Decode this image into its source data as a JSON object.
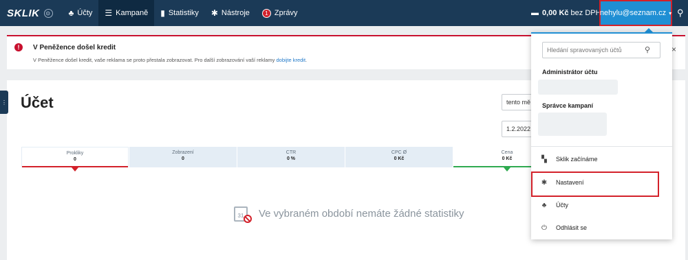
{
  "nav": {
    "logo": "SKLIK",
    "logo_badge": "⊙",
    "items": [
      {
        "label": "Účty",
        "icon": "accounts-icon",
        "glyph": "♣"
      },
      {
        "label": "Kampaně",
        "icon": "list-icon",
        "glyph": "☰"
      },
      {
        "label": "Statistiky",
        "icon": "bar-chart-icon",
        "glyph": "▮"
      },
      {
        "label": "Nástroje",
        "icon": "gear-icon",
        "glyph": "✱"
      },
      {
        "label": "Zprávy",
        "icon": "messages-icon",
        "badge": "1"
      }
    ],
    "credit_amount": "0,00 Kč",
    "credit_suffix": "bez DPH",
    "credit_caret": "▾",
    "user_email": "nehylu@seznam.cz",
    "user_caret": "▾"
  },
  "alert": {
    "title": "V Peněžence došel kredit",
    "text": "V Peněžence došel kredit, vaše reklama se proto přestala zobrazovat. Pro další zobrazování vaší reklamy ",
    "link": "dobijte kredit",
    "text_end": ".",
    "close": "×"
  },
  "page": {
    "title": "Účet",
    "period_select": "tento mě",
    "date_field": "1.2.2022"
  },
  "stats": [
    {
      "label": "Prokliky",
      "value": "0"
    },
    {
      "label": "Zobrazení",
      "value": "0"
    },
    {
      "label": "CTR",
      "value": "0 %"
    },
    {
      "label": "CPC Ø",
      "value": "0 Kč"
    },
    {
      "label": "Cena",
      "value": "0 Kč"
    }
  ],
  "empty": {
    "calendar_day": "31",
    "message": "Ve vybraném období nemáte žádné statistiky"
  },
  "dropdown": {
    "search_placeholder": "Hledání spravovaných účtů",
    "admin_heading": "Administrátor účtu",
    "manager_heading": "Správce kampaní",
    "items": [
      {
        "label": "Sklik začínáme",
        "glyph": "▚"
      },
      {
        "label": "Nastavení",
        "glyph": "✱"
      },
      {
        "label": "Účty",
        "glyph": "♣"
      },
      {
        "label": "Odhlásit se",
        "glyph": "⏻"
      }
    ]
  },
  "colors": {
    "topbar": "#1b3a57",
    "user_button": "#1f8fd4",
    "highlight": "#d32029",
    "alert_red": "#c8102e",
    "stat_red": "#d32029",
    "stat_green": "#2eaa4f"
  }
}
